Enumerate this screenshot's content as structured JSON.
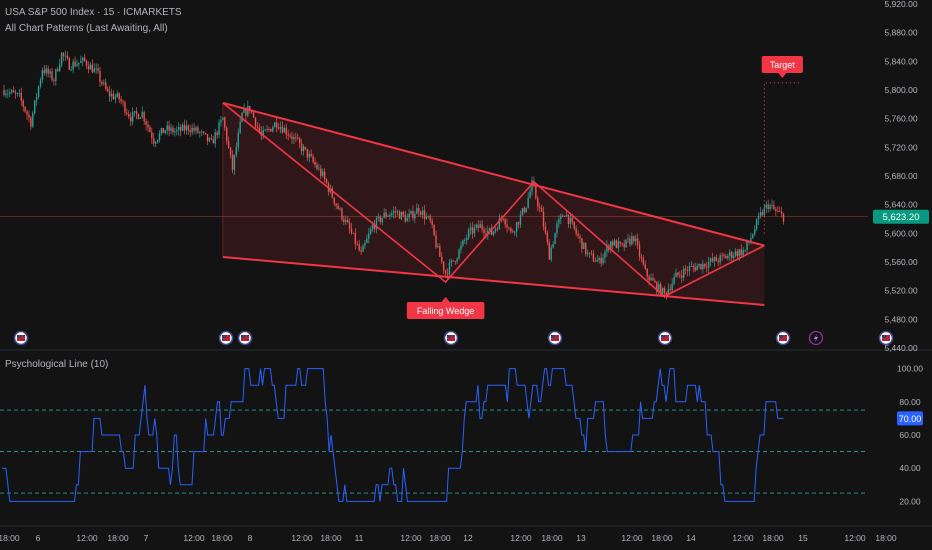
{
  "header": {
    "symbol_line": "USA S&P 500 Index · 15 · ICMARKETS",
    "indicator_line": "All Chart Patterns (Last Awaiting, All)"
  },
  "colors": {
    "background": "#131313",
    "up_candle": "#26a69a",
    "down_candle": "#ef5350",
    "pattern": "#f23645",
    "indicator_line": "#2962ff",
    "last_price": "#089981",
    "indicator_tag": "#2962ff",
    "level_line": "#26a69a"
  },
  "main_pane": {
    "y_ticks": [
      "5,920.00",
      "5,880.00",
      "5,840.00",
      "5,800.00",
      "5,760.00",
      "5,720.00",
      "5,680.00",
      "5,640.00",
      "5,600.00",
      "5,560.00",
      "5,520.00",
      "5,480.00",
      "5,440.00"
    ],
    "last_price_label": "5,623.20",
    "pattern_label": "Falling Wedge",
    "target_label": "Target",
    "event_icons": [
      "us-flag-icon",
      "us-flag-icon",
      "us-flag-icon",
      "us-flag-icon",
      "us-flag-icon",
      "us-flag-icon",
      "us-flag-icon",
      "lightning-icon",
      "us-flag-icon"
    ]
  },
  "indicator_pane": {
    "title": "Psychological Line (10)",
    "y_ticks": [
      "100.00",
      "80.00",
      "60.00",
      "40.00",
      "20.00"
    ],
    "levels": [
      75,
      50,
      25
    ],
    "last_value_label": "70.00"
  },
  "x_axis": {
    "ticks": [
      "18:00",
      "6",
      "12:00",
      "18:00",
      "7",
      "12:00",
      "18:00",
      "8",
      "12:00",
      "18:00",
      "11",
      "12:00",
      "18:00",
      "12",
      "12:00",
      "18:00",
      "13",
      "12:00",
      "18:00",
      "14",
      "12:00",
      "18:00",
      "15",
      "12:00",
      "18:00"
    ]
  },
  "chart_data": [
    {
      "type": "candlestick",
      "title": "USA S&P 500 Index · 15 · ICMARKETS",
      "ylim": [
        5440,
        5920
      ],
      "last_price": 5623.2,
      "anchors": [
        {
          "t": 0,
          "p": 5800
        },
        {
          "t": 8,
          "p": 5790
        },
        {
          "t": 14,
          "p": 5755
        },
        {
          "t": 20,
          "p": 5830
        },
        {
          "t": 26,
          "p": 5815
        },
        {
          "t": 30,
          "p": 5850
        },
        {
          "t": 34,
          "p": 5835
        },
        {
          "t": 42,
          "p": 5840
        },
        {
          "t": 48,
          "p": 5825
        },
        {
          "t": 54,
          "p": 5795
        },
        {
          "t": 60,
          "p": 5788
        },
        {
          "t": 66,
          "p": 5762
        },
        {
          "t": 72,
          "p": 5768
        },
        {
          "t": 78,
          "p": 5730
        },
        {
          "t": 84,
          "p": 5745
        },
        {
          "t": 90,
          "p": 5742
        },
        {
          "t": 96,
          "p": 5748
        },
        {
          "t": 102,
          "p": 5740
        },
        {
          "t": 108,
          "p": 5725
        },
        {
          "t": 114,
          "p": 5760
        },
        {
          "t": 119,
          "p": 5690
        },
        {
          "t": 124,
          "p": 5765
        },
        {
          "t": 128,
          "p": 5775
        },
        {
          "t": 134,
          "p": 5735
        },
        {
          "t": 142,
          "p": 5755
        },
        {
          "t": 150,
          "p": 5735
        },
        {
          "t": 158,
          "p": 5710
        },
        {
          "t": 166,
          "p": 5680
        },
        {
          "t": 174,
          "p": 5635
        },
        {
          "t": 180,
          "p": 5605
        },
        {
          "t": 186,
          "p": 5570
        },
        {
          "t": 192,
          "p": 5610
        },
        {
          "t": 198,
          "p": 5625
        },
        {
          "t": 204,
          "p": 5630
        },
        {
          "t": 210,
          "p": 5620
        },
        {
          "t": 216,
          "p": 5635
        },
        {
          "t": 222,
          "p": 5615
        },
        {
          "t": 226,
          "p": 5575
        },
        {
          "t": 230,
          "p": 5545
        },
        {
          "t": 236,
          "p": 5570
        },
        {
          "t": 242,
          "p": 5600
        },
        {
          "t": 248,
          "p": 5610
        },
        {
          "t": 254,
          "p": 5600
        },
        {
          "t": 260,
          "p": 5625
        },
        {
          "t": 264,
          "p": 5600
        },
        {
          "t": 268,
          "p": 5618
        },
        {
          "t": 272,
          "p": 5640
        },
        {
          "t": 275,
          "p": 5668
        },
        {
          "t": 280,
          "p": 5625
        },
        {
          "t": 284,
          "p": 5570
        },
        {
          "t": 288,
          "p": 5610
        },
        {
          "t": 292,
          "p": 5630
        },
        {
          "t": 298,
          "p": 5600
        },
        {
          "t": 304,
          "p": 5570
        },
        {
          "t": 310,
          "p": 5560
        },
        {
          "t": 316,
          "p": 5588
        },
        {
          "t": 322,
          "p": 5580
        },
        {
          "t": 328,
          "p": 5595
        },
        {
          "t": 334,
          "p": 5545
        },
        {
          "t": 340,
          "p": 5525
        },
        {
          "t": 344,
          "p": 5515
        },
        {
          "t": 350,
          "p": 5540
        },
        {
          "t": 356,
          "p": 5550
        },
        {
          "t": 362,
          "p": 5555
        },
        {
          "t": 368,
          "p": 5560
        },
        {
          "t": 374,
          "p": 5565
        },
        {
          "t": 380,
          "p": 5572
        },
        {
          "t": 386,
          "p": 5576
        },
        {
          "t": 390,
          "p": 5600
        },
        {
          "t": 394,
          "p": 5625
        },
        {
          "t": 398,
          "p": 5640
        },
        {
          "t": 402,
          "p": 5630
        },
        {
          "t": 406,
          "p": 5623.2
        }
      ],
      "candle_count": 406
    },
    {
      "type": "line",
      "title": "Psychological Line (10)",
      "ylim": [
        10,
        110
      ],
      "levels": [
        75,
        50,
        25
      ],
      "last_value": 70,
      "step": 10,
      "length": 400
    }
  ]
}
